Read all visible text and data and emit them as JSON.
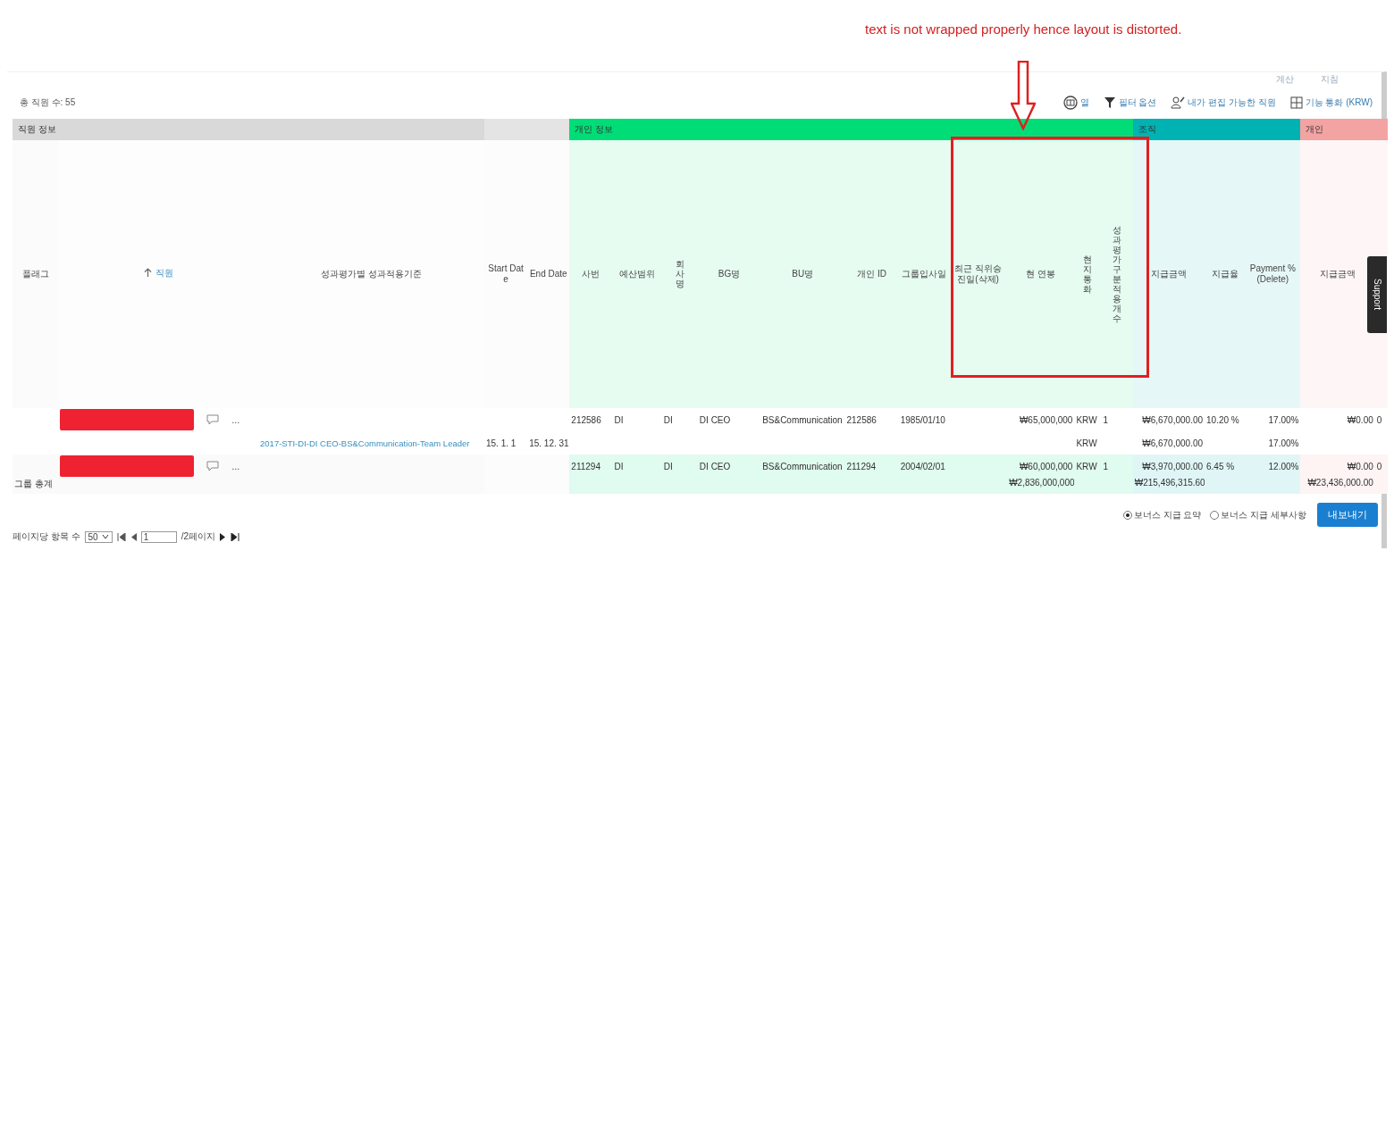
{
  "annotation": {
    "text": "text is not wrapped properly hence layout is distorted."
  },
  "top_links": [
    "계산",
    "지침"
  ],
  "total_count": "총 직원 수: 55",
  "toolbar": [
    {
      "label": "열",
      "kind": "columns"
    },
    {
      "label": "필터 옵션",
      "kind": "filter"
    },
    {
      "label": "내가 편집 가능한 직원",
      "kind": "person"
    },
    {
      "label": "기능 통화 (KRW)",
      "kind": "currency"
    }
  ],
  "table": {
    "groups": [
      {
        "label": "직원 정보",
        "color": "#d9d9d9"
      },
      {
        "color": "#e4e4e4"
      },
      {
        "label": "개인 정보",
        "color": "#00dd77"
      },
      {
        "label": "조직",
        "color": "#00b2b2"
      },
      {
        "label": "개인",
        "color": "#f4a3a3"
      }
    ],
    "columns": [
      {
        "label": "플래그",
        "kind": "text"
      },
      {
        "label": "직원",
        "kind": "sort"
      },
      {
        "label": "성과평가별 성과적용기준",
        "kind": "text"
      },
      {
        "label": "Start Date",
        "kind": "text"
      },
      {
        "label": "End Date",
        "kind": "text"
      },
      {
        "label": "사번",
        "kind": "text"
      },
      {
        "label": "예산범위",
        "kind": "text"
      },
      {
        "label": "회사명",
        "kind": "vertical"
      },
      {
        "label": "BG명",
        "kind": "text"
      },
      {
        "label": "BU명",
        "kind": "text"
      },
      {
        "label": "개인 ID",
        "kind": "text"
      },
      {
        "label": "그룹입사일",
        "kind": "text"
      },
      {
        "label": "최근 직위승진일(삭제)",
        "kind": "text"
      },
      {
        "label": "현 연봉",
        "kind": "text"
      },
      {
        "label": "현지통화",
        "kind": "vertical"
      },
      {
        "label": "성과평가구분적용개수",
        "kind": "vertical"
      },
      {
        "label": "지급금액",
        "kind": "text"
      },
      {
        "label": "지급율",
        "kind": "text"
      },
      {
        "label": "Payment % (Delete)",
        "kind": "text"
      },
      {
        "label": "지급금액",
        "kind": "text"
      },
      {
        "kind": "text"
      }
    ],
    "rows": [
      {
        "kind": "employee",
        "shaded": false,
        "more": "...",
        "cells": [
          null,
          null,
          null,
          null,
          null,
          "212586",
          "DI",
          "DI",
          "DI CEO",
          "BS&Communication",
          "212586",
          "1985/01/10",
          null,
          "₩65,000,000",
          "KRW",
          "1",
          "₩6,670,000.00",
          "10.20 %",
          "17.00%",
          "₩0.00",
          "0"
        ]
      },
      {
        "kind": "criteria",
        "shaded": false,
        "cells": [
          null,
          null,
          "2017-STI-DI-DI CEO-BS&Communication-Team Leader",
          "15. 1. 1",
          "15. 12. 31",
          null,
          null,
          null,
          null,
          null,
          null,
          null,
          null,
          null,
          "KRW",
          null,
          "₩6,670,000.00",
          null,
          "17.00%",
          null,
          null
        ]
      },
      {
        "kind": "employee",
        "shaded": true,
        "more": "...",
        "cells": [
          null,
          null,
          null,
          null,
          null,
          "211294",
          "DI",
          "DI",
          "DI CEO",
          "BS&Communication",
          "211294",
          "2004/02/01",
          null,
          "₩60,000,000",
          "KRW",
          "1",
          "₩3,970,000.00",
          "6.45 %",
          "12.00%",
          "₩0.00",
          "0"
        ]
      },
      {
        "kind": "total",
        "shaded": true,
        "cells": [
          "그룹 총계",
          null,
          null,
          null,
          null,
          null,
          null,
          null,
          null,
          null,
          null,
          null,
          null,
          "₩2,836,000,000",
          null,
          null,
          "₩215,496,315.60",
          null,
          null,
          "₩23,436,000.00",
          null
        ]
      }
    ]
  },
  "support_tab": "Support",
  "footer": {
    "radios": [
      {
        "label": "보너스 지급 요약",
        "selected": true
      },
      {
        "label": "보너스 지급 세부사항",
        "selected": false
      }
    ],
    "export_button": "내보내기",
    "page_size_label": "페이지당 항목 수",
    "page_size": "50",
    "page": "1",
    "page_total": "/2페이지"
  }
}
